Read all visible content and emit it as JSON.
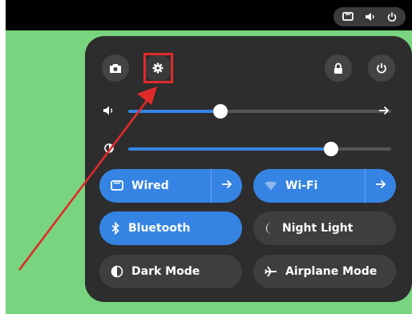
{
  "colors": {
    "accent": "#3584e4",
    "panel": "#2d2d2d",
    "desktop": "#79d47f",
    "annotation": "#e02a2a"
  },
  "topbar": {
    "icons": [
      "screen-icon",
      "speaker-icon",
      "power-icon"
    ]
  },
  "panel": {
    "buttons": [
      "screenshot-icon",
      "settings-icon",
      "lock-icon",
      "power-icon"
    ],
    "volume": {
      "level": 0.35
    },
    "brightness": {
      "level": 0.77
    },
    "toggles": {
      "wired": {
        "label": "Wired",
        "active": true
      },
      "wifi": {
        "label": "Wi-Fi",
        "active": true
      },
      "bluetooth": {
        "label": "Bluetooth",
        "active": true
      },
      "night_light": {
        "label": "Night Light",
        "active": false
      },
      "dark_mode": {
        "label": "Dark Mode",
        "active": false
      },
      "airplane_mode": {
        "label": "Airplane Mode",
        "active": false
      }
    }
  }
}
